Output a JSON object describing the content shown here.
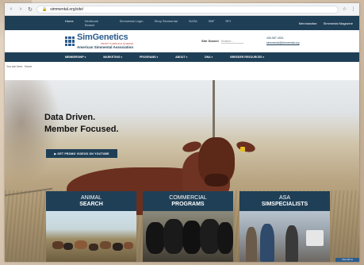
{
  "browser": {
    "url": "simmental.org/site/",
    "nav": [
      "‹",
      "›",
      "↻"
    ]
  },
  "top_nav": {
    "links": [
      "Home",
      "Herdbook Search",
      "Simmental Login",
      "Shop Simmental",
      "SUSA",
      "SBF",
      "RFI"
    ],
    "right": [
      "Merchandise",
      "Simmental Magazine"
    ]
  },
  "header": {
    "logo_name": "SimGenetics",
    "logo_tag": "PROFIT THROUGH SCIENCE",
    "logo_assoc": "American Simmental Association",
    "search_label": "Site Search",
    "search_placeholder": "Search...",
    "phone": "406-587-4531",
    "email": "simmental@simmental.org"
  },
  "main_menu": [
    "MEMBERSHIP",
    "MARKETING",
    "PROGRAMS",
    "ABOUT",
    "DNA",
    "BREEDER RESOURCES"
  ],
  "breadcrumb": {
    "prefix": "You are here:",
    "current": "Home"
  },
  "hero": {
    "title_line1": "Data Driven.",
    "title_line2": "Member Focused.",
    "button": "▶ GET PROMO VIDEOS ON YOUTUBE"
  },
  "cards": [
    {
      "line1": "ANIMAL",
      "line2": "SEARCH"
    },
    {
      "line1": "COMMERCIAL",
      "line2": "PROGRAMS"
    },
    {
      "line1": "ASA",
      "line2": "SIMSPECIALISTS"
    }
  ],
  "chat": "Chat with us"
}
